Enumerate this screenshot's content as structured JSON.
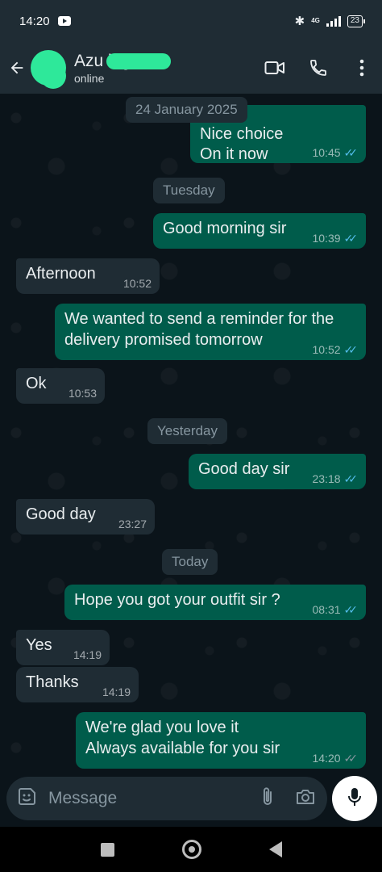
{
  "status_bar": {
    "time": "14:20",
    "network": "4G",
    "battery": "23"
  },
  "header": {
    "contact_name": "Azu      lagos",
    "status": "online"
  },
  "chat": {
    "date_chips": {
      "jan": "24 January 2025",
      "tuesday": "Tuesday",
      "yesterday": "Yesterday",
      "today": "Today"
    },
    "messages": [
      {
        "dir": "out",
        "line1": "Nice choice",
        "line2": "On it now",
        "time": "10:45",
        "read": true
      },
      {
        "dir": "out",
        "text": "Good morning sir",
        "time": "10:39",
        "read": true
      },
      {
        "dir": "in",
        "text": "Afternoon",
        "time": "10:52"
      },
      {
        "dir": "out",
        "line1": "We wanted to send a reminder for the",
        "line2": "delivery promised tomorrow",
        "time": "10:52",
        "read": true
      },
      {
        "dir": "in",
        "text": "Ok",
        "time": "10:53"
      },
      {
        "dir": "out",
        "text": "Good day sir",
        "time": "23:18",
        "read": true
      },
      {
        "dir": "in",
        "text": "Good day",
        "time": "23:27"
      },
      {
        "dir": "out",
        "text": "Hope you got your outfit sir ?",
        "time": "08:31",
        "read": true
      },
      {
        "dir": "in",
        "text": "Yes",
        "time": "14:19"
      },
      {
        "dir": "in",
        "text": "Thanks",
        "time": "14:19"
      },
      {
        "dir": "out",
        "line1": "We're glad you love it",
        "line2": "Always available for you sir",
        "time": "14:20",
        "read": false
      }
    ]
  },
  "composer": {
    "placeholder": "Message"
  },
  "icons": {
    "back": "arrow-left-icon",
    "video": "video-call-icon",
    "call": "phone-icon",
    "menu": "more-vertical-icon",
    "sticker": "sticker-icon",
    "attach": "paperclip-icon",
    "camera": "camera-icon",
    "mic": "microphone-icon"
  },
  "colors": {
    "outgoing_bubble": "#005c4b",
    "incoming_bubble": "#1f2c34",
    "read_tick": "#53bdeb",
    "header": "#1f2c34"
  }
}
